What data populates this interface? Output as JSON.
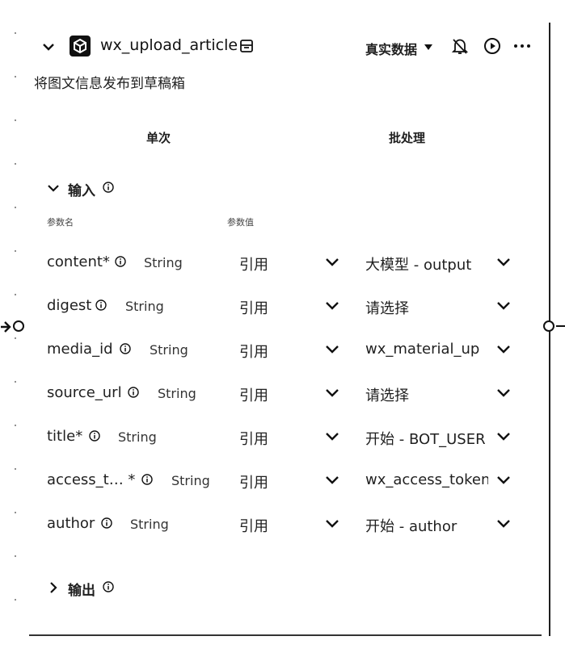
{
  "node": {
    "title": "wx_upload_article",
    "description": "将图文信息发布到草稿箱",
    "data_mode": "真实数据"
  },
  "tabs": {
    "single": "单次",
    "batch": "批处理"
  },
  "input_section": {
    "label": "输入"
  },
  "output_section": {
    "label": "输出"
  },
  "columns": {
    "param_name": "参数名",
    "param_value": "参数值"
  },
  "params": [
    {
      "name": "content*",
      "type": "String",
      "ref": "引用",
      "value": "大模型 - output"
    },
    {
      "name": "digest",
      "type": "String",
      "ref": "引用",
      "value": "请选择"
    },
    {
      "name": "media_id",
      "type": "String",
      "ref": "引用",
      "value": "wx_material_up"
    },
    {
      "name": "source_url",
      "type": "String",
      "ref": "引用",
      "value": "请选择"
    },
    {
      "name": "title*",
      "type": "String",
      "ref": "引用",
      "value": "开始 - BOT_USER"
    },
    {
      "name": "access_t… *",
      "type": "String",
      "ref": "引用",
      "value": "wx_access_token"
    },
    {
      "name": "author",
      "type": "String",
      "ref": "引用",
      "value": "开始 - author"
    }
  ],
  "colors": {
    "text": "#1f1f1f",
    "icon": "#111111"
  }
}
